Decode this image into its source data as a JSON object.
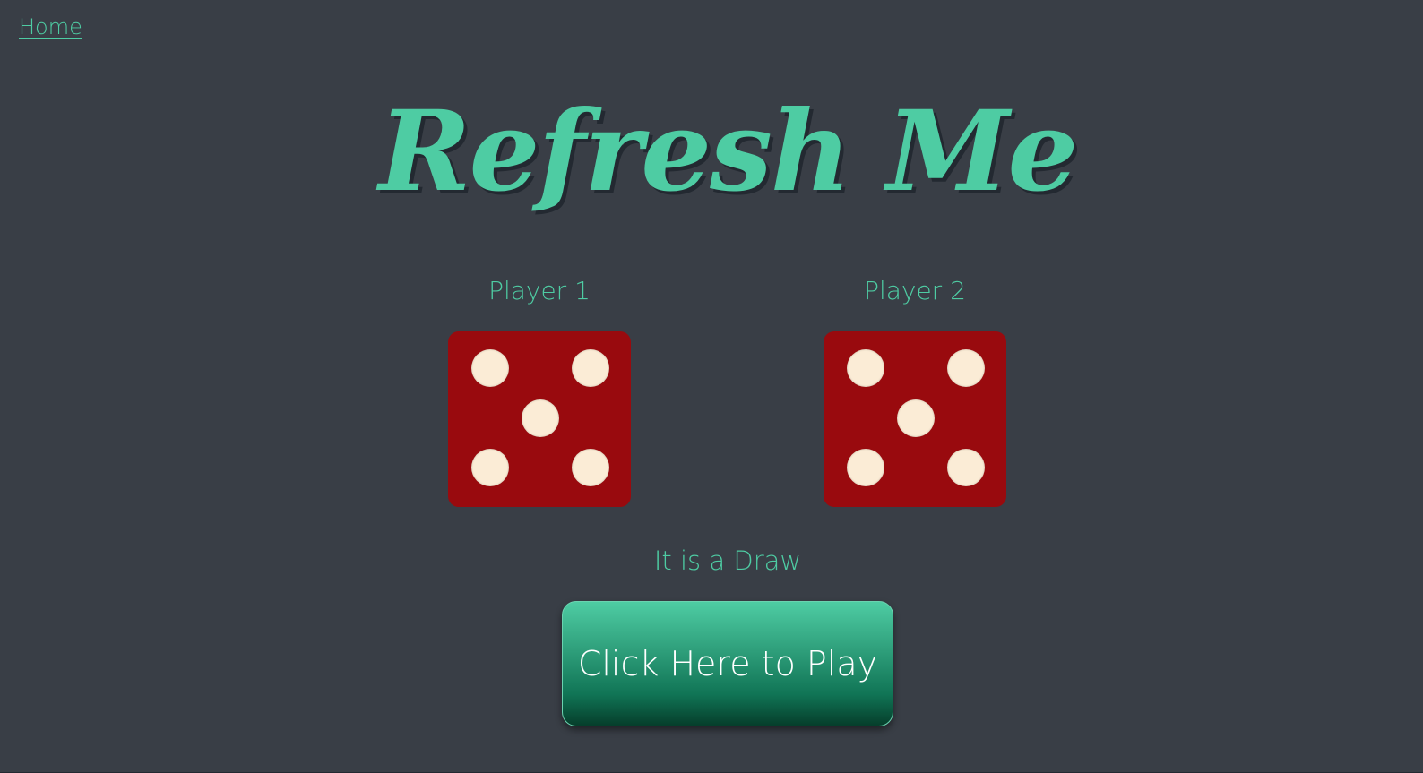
{
  "nav": {
    "home_label": "Home"
  },
  "header": {
    "title": "Refresh Me"
  },
  "players": [
    {
      "label": "Player 1",
      "die_value": 5
    },
    {
      "label": "Player 2",
      "die_value": 5
    }
  ],
  "result": {
    "text": "It is a Draw"
  },
  "play_button": {
    "label": "Click Here to Play"
  },
  "colors": {
    "background": "#393e46",
    "accent": "#4ecca3",
    "die_face": "#990a0e",
    "pip": "#fbecd6"
  },
  "icons": {
    "die": "dice-five-icon"
  }
}
